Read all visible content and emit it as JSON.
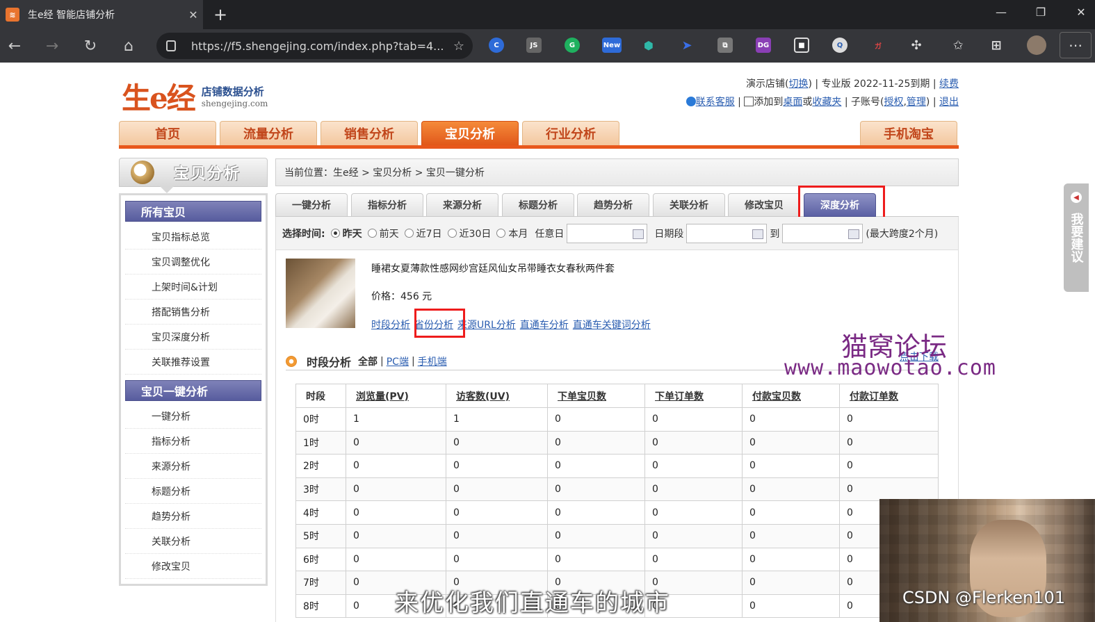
{
  "browser": {
    "tab_title": "生e经 智能店铺分析",
    "url": "https://f5.shengejing.com/index.php?tab=4...",
    "new_badge": "New",
    "dg_badge": "DG"
  },
  "header": {
    "logo_mark": "生e经",
    "logo_cn": "店铺数据分析",
    "logo_en": "shengejing.com",
    "shop_prefix": "演示店铺(",
    "switch_link": "切换",
    "shop_suffix": ") | 专业版 2022-11-25到期 |",
    "renew_link": "续费",
    "service_link": "联系客服",
    "add_text": "添加到",
    "desktop_link": "桌面",
    "or_text": "或",
    "favorites_link": "收藏夹",
    "subaccount_text": "| 子账号(",
    "auth_link": "授权",
    "manage_link": "管理",
    "logout_link": "退出"
  },
  "main_nav": [
    "首页",
    "流量分析",
    "销售分析",
    "宝贝分析",
    "行业分析",
    "手机淘宝"
  ],
  "sidebar": {
    "title": "宝贝分析",
    "group1": "所有宝贝",
    "items1": [
      "宝贝指标总览",
      "宝贝调整优化",
      "上架时间&计划",
      "搭配销售分析",
      "宝贝深度分析",
      "关联推荐设置"
    ],
    "group2": "宝贝一键分析",
    "items2": [
      "一键分析",
      "指标分析",
      "来源分析",
      "标题分析",
      "趋势分析",
      "关联分析",
      "修改宝贝"
    ]
  },
  "breadcrumb": "当前位置：生e经 > 宝贝分析 > 宝贝一键分析",
  "subtabs": [
    "一键分析",
    "指标分析",
    "来源分析",
    "标题分析",
    "趋势分析",
    "关联分析",
    "修改宝贝",
    "深度分析"
  ],
  "timebar": {
    "label": "选择时间:",
    "options": [
      "昨天",
      "前天",
      "近7日",
      "近30日",
      "本月"
    ],
    "any_day": "任意日",
    "date_range": "日期段",
    "to": "到",
    "note": "(最大跨度2个月)"
  },
  "product": {
    "title": "睡裙女夏薄款性感网纱宫廷风仙女吊带睡衣女春秋两件套",
    "price": "价格：456 元",
    "links": [
      "时段分析",
      "省份分析",
      "来源URL分析",
      "直通车分析",
      "直通车关键词分析"
    ]
  },
  "section": {
    "title": "时段分析",
    "all": "全部",
    "pc": "PC端",
    "mobile": "手机端",
    "download": "点击下载"
  },
  "table": {
    "headers": [
      "时段",
      "浏览量(PV)",
      "访客数(UV)",
      "下单宝贝数",
      "下单订单数",
      "付款宝贝数",
      "付款订单数"
    ],
    "rows": [
      [
        "0时",
        "1",
        "1",
        "0",
        "0",
        "0",
        "0"
      ],
      [
        "1时",
        "0",
        "0",
        "0",
        "0",
        "0",
        "0"
      ],
      [
        "2时",
        "0",
        "0",
        "0",
        "0",
        "0",
        "0"
      ],
      [
        "3时",
        "0",
        "0",
        "0",
        "0",
        "0",
        "0"
      ],
      [
        "4时",
        "0",
        "0",
        "0",
        "0",
        "0",
        "0"
      ],
      [
        "5时",
        "0",
        "0",
        "0",
        "0",
        "0",
        "0"
      ],
      [
        "6时",
        "0",
        "0",
        "0",
        "0",
        "0",
        "0"
      ],
      [
        "7时",
        "0",
        "0",
        "0",
        "0",
        "0",
        "0"
      ],
      [
        "8时",
        "0",
        "0",
        "0",
        "0",
        "0",
        "0"
      ]
    ]
  },
  "overlay": {
    "watermark_cn": "猫窝论坛",
    "watermark_url": "www.maowotao.com",
    "suggest": "我要建议",
    "subtitle": "来优化我们直通车的城市",
    "csdn": "CSDN @Flerken101"
  }
}
